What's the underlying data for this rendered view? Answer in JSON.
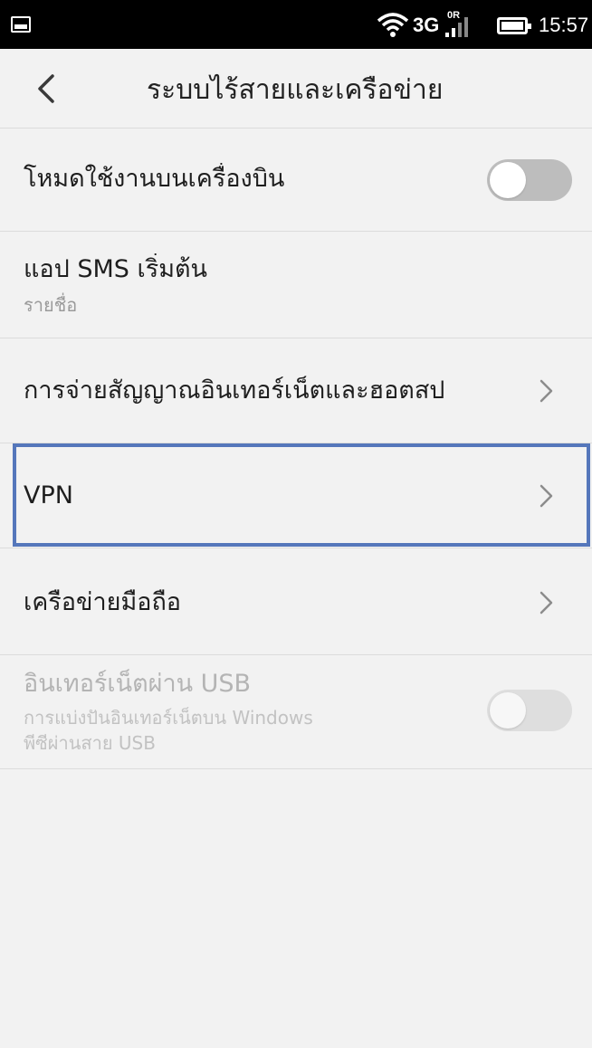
{
  "status_bar": {
    "network": "3G",
    "signal_badge": "0R",
    "time": "15:57",
    "icons": [
      "gallery-notification-icon",
      "wifi-icon",
      "signal-icon",
      "battery-icon"
    ]
  },
  "header": {
    "back_icon": "chevron-left-icon",
    "title": "ระบบไร้สายและเครือข่าย"
  },
  "settings": [
    {
      "title": "โหมดใช้งานบนเครื่องบิน",
      "control": "toggle",
      "on": false
    },
    {
      "title": "แอป SMS เริ่มต้น",
      "subtitle": "รายชื่อ"
    },
    {
      "title": "การจ่ายสัญญาณอินเทอร์เน็ตและฮอตสป",
      "control": "chevron"
    },
    {
      "title": "VPN",
      "control": "chevron",
      "highlighted": true
    },
    {
      "title": "เครือข่ายมือถือ",
      "control": "chevron"
    },
    {
      "title": "อินเทอร์เน็ตผ่าน USB",
      "subtitle_line1": "การแบ่งปันอินเทอร์เน็ตบน Windows",
      "subtitle_line2": "พีซีผ่านสาย USB",
      "control": "toggle",
      "on": false,
      "disabled": true
    }
  ],
  "colors": {
    "background": "#f2f2f2",
    "status_bar": "#000000",
    "toggle_off": "#bdbdbd",
    "highlight": "#5577bb",
    "divider": "#dcdcdc"
  }
}
